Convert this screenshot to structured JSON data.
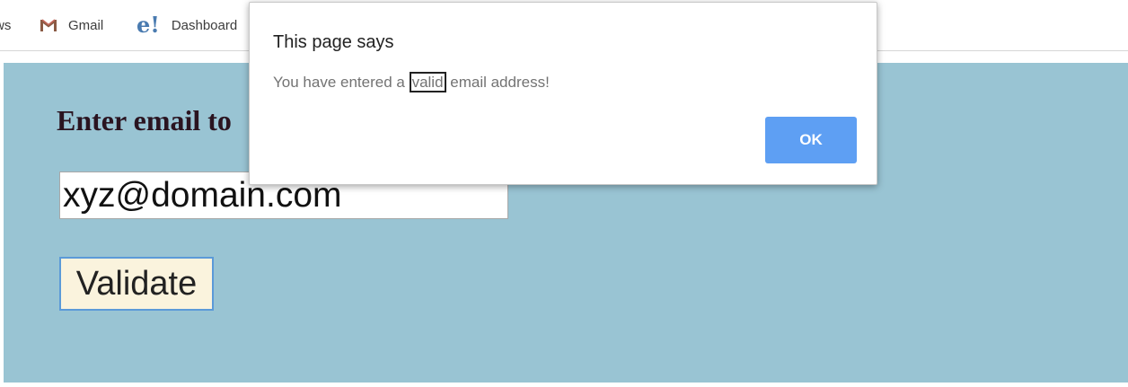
{
  "bookmarks": {
    "news_label": "ws",
    "gmail_label": "Gmail",
    "gmail_icon": "gmail-icon",
    "dashboard_label": "Dashboard",
    "dashboard_icon": "e-icon"
  },
  "page": {
    "background_color": "#99c4d3",
    "heading": "Enter email to",
    "email_input_value": "xyz@domain.com",
    "validate_button_label": "Validate"
  },
  "dialog": {
    "title": "This page says",
    "message_before": "You have entered a ",
    "message_highlight": "valid",
    "message_after": " email address!",
    "ok_label": "OK",
    "ok_color": "#5e9ff3"
  }
}
